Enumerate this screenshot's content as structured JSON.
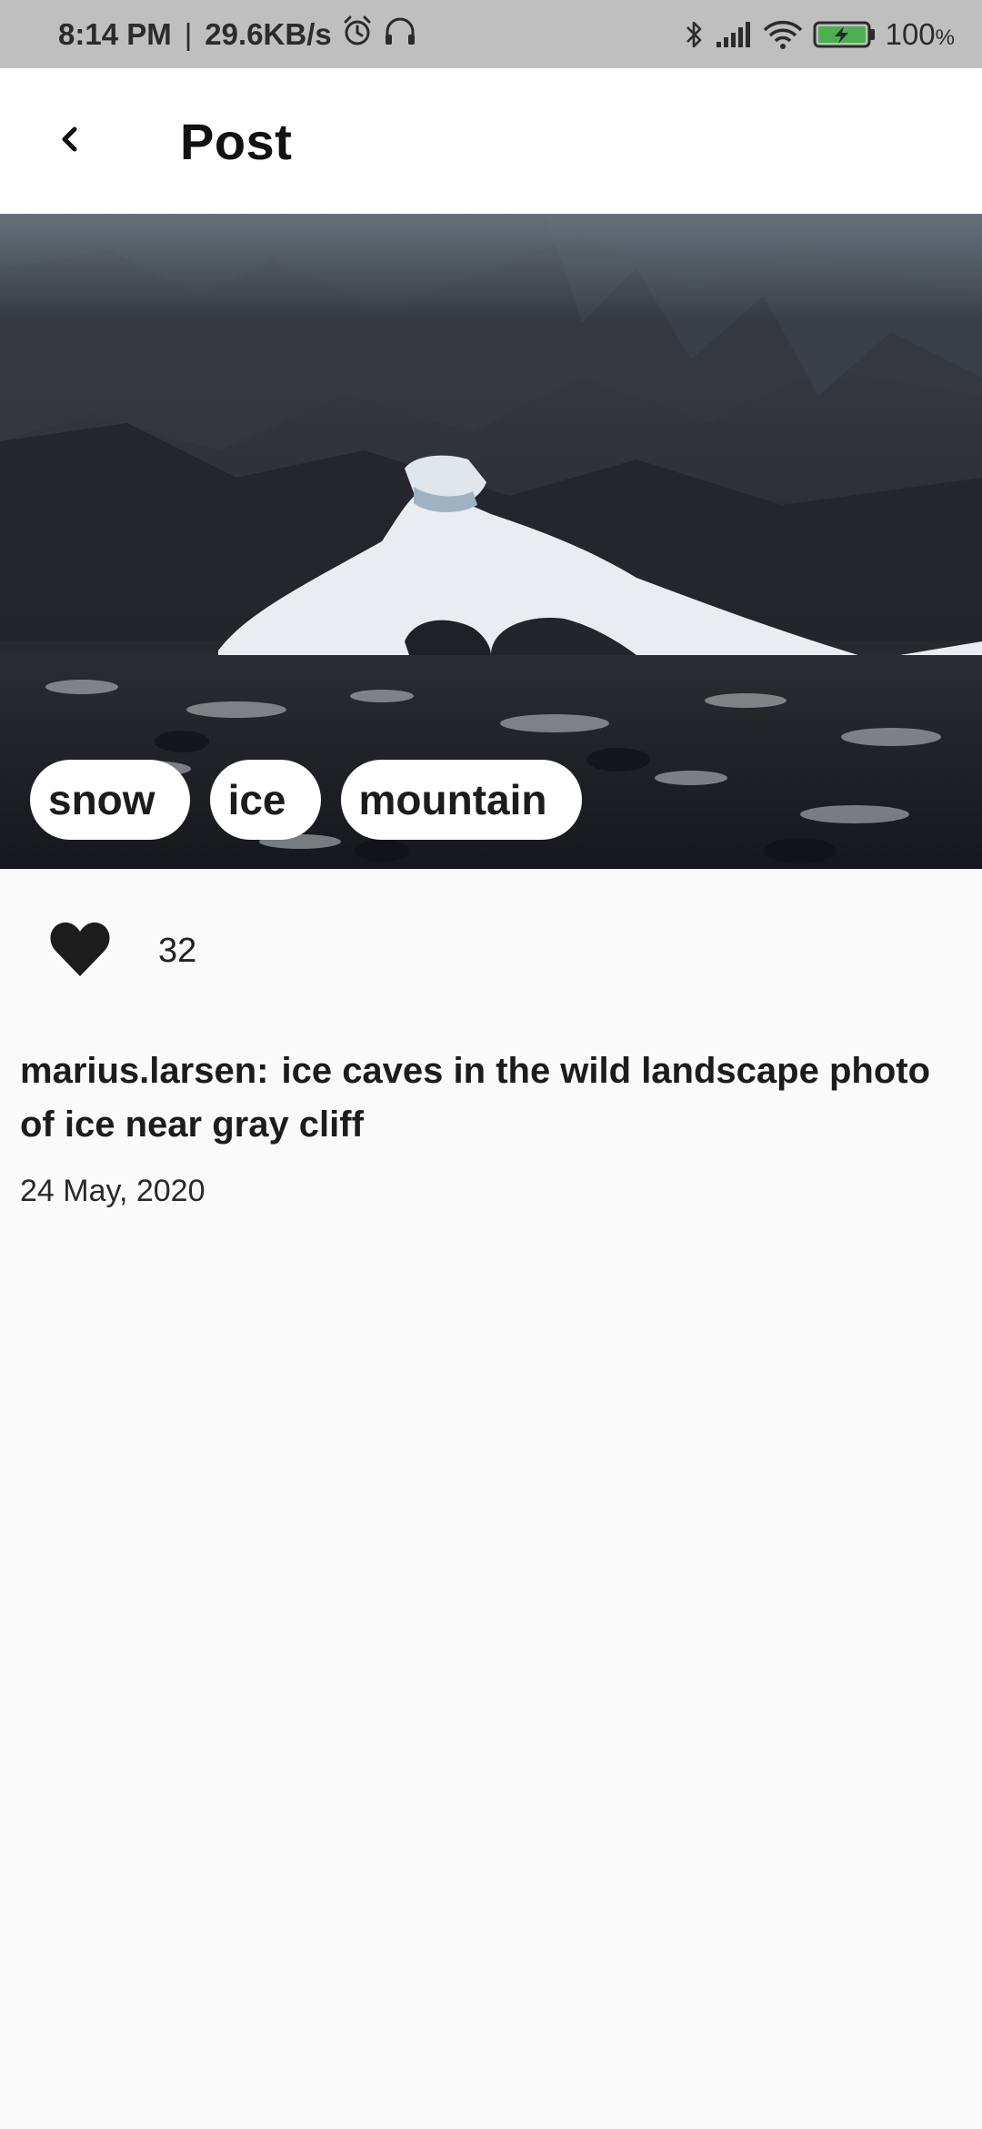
{
  "status_bar": {
    "time": "8:14 PM",
    "separator": "|",
    "network_speed": "29.6KB/s",
    "battery_percent": "100",
    "battery_unit": "%",
    "icons": [
      "alarm-icon",
      "headphones-icon",
      "bluetooth-icon",
      "signal-icon",
      "wifi-icon",
      "battery-charging-icon"
    ],
    "battery_color": "#4caf50"
  },
  "app_bar": {
    "title": "Post",
    "back_icon": "chevron-left-icon"
  },
  "post": {
    "image_alt": "ice caves in the wild landscape",
    "tags": [
      "snow",
      "ice",
      "mountain"
    ],
    "likes": {
      "icon": "heart-icon",
      "count": "32"
    },
    "author": "marius.larsen:",
    "caption": "ice caves in the wild landscape photo of ice near gray cliff",
    "date": "24 May, 2020"
  }
}
